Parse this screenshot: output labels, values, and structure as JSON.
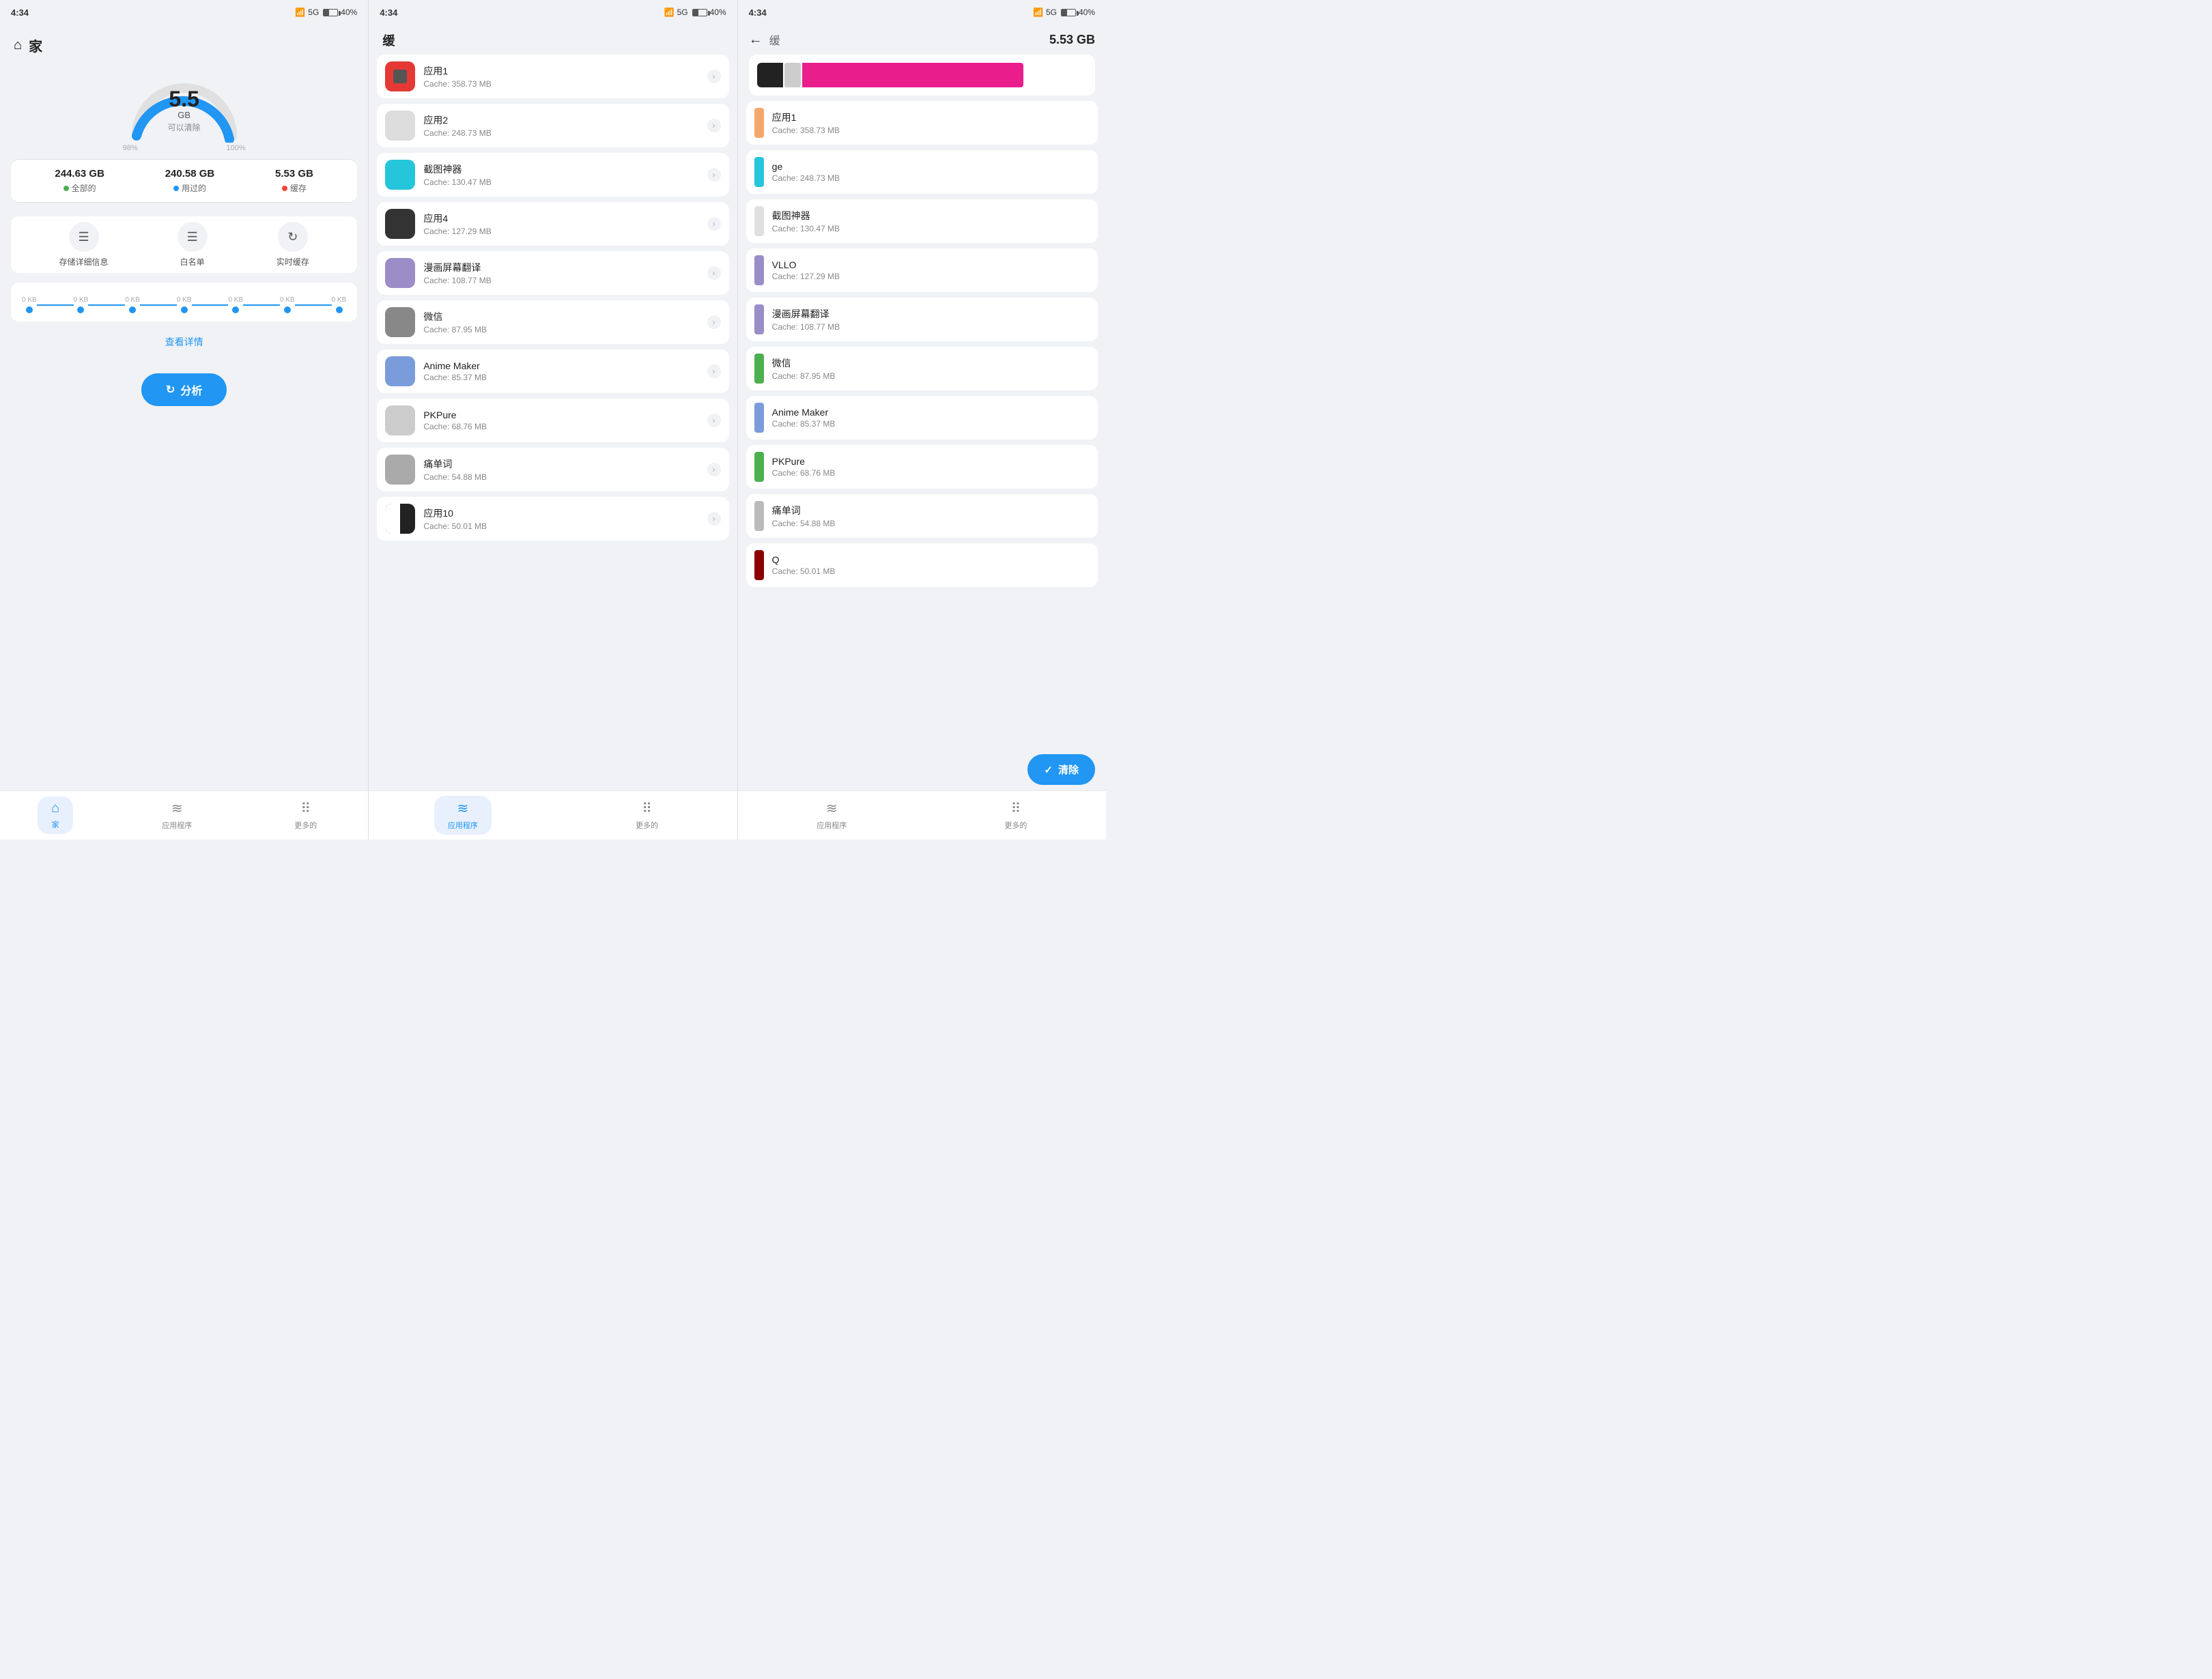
{
  "panels": [
    {
      "id": "panel1",
      "statusBar": {
        "time": "4:34",
        "battery": "40%",
        "signal": "5G"
      },
      "header": {
        "title": "家",
        "homeIcon": "⌂"
      },
      "gauge": {
        "value": "5.5",
        "unit": "GB",
        "label": "可以清除",
        "percent98": "98%",
        "percent100": "100%"
      },
      "stats": [
        {
          "value": "244.63 GB",
          "label": "全部的",
          "dotClass": "dot-green"
        },
        {
          "value": "240.58 GB",
          "label": "用过的",
          "dotClass": "dot-blue"
        },
        {
          "value": "5.53 GB",
          "label": "缓存",
          "dotClass": "dot-red"
        }
      ],
      "actions": [
        {
          "id": "storage-detail",
          "icon": "☰",
          "label": "存储详细信息"
        },
        {
          "id": "whitelist",
          "icon": "☰",
          "label": "白名单"
        },
        {
          "id": "realtime-cache",
          "icon": "↻",
          "label": "实时缓存"
        }
      ],
      "progressLabels": [
        "0 KB",
        "0 KB",
        "0 KB",
        "0 KB",
        "0 KB",
        "0 KB",
        "0 KB"
      ],
      "viewDetailsLabel": "查看详情",
      "analyzeLabel": "分析",
      "bottomNav": [
        {
          "id": "home",
          "icon": "⌂",
          "label": "家",
          "active": true
        },
        {
          "id": "apps",
          "icon": "≋",
          "label": "应用程序",
          "active": false
        },
        {
          "id": "more",
          "icon": "⠿",
          "label": "更多的",
          "active": false
        }
      ]
    },
    {
      "id": "panel2",
      "statusBar": {
        "time": "4:34",
        "battery": "40%"
      },
      "header": {
        "title": "缓"
      },
      "apps": [
        {
          "name": "应用1",
          "size": "Cache: 358.73 MB",
          "color": "#e53935"
        },
        {
          "name": "应用2",
          "size": "Cache: 248.73 MB",
          "color": "#bbb"
        },
        {
          "name": "截图神器",
          "size": "Cache: 130.47 MB",
          "color": "#5bb"
        },
        {
          "name": "应用4",
          "size": "Cache: 127.29 MB",
          "color": "#333"
        },
        {
          "name": "漫画屏幕翻译",
          "size": "Cache: 108.77 MB",
          "color": "#9b8dc8"
        },
        {
          "name": "微信",
          "size": "Cache: 87.95 MB",
          "color": "#777"
        },
        {
          "name": "Anime Maker",
          "size": "Cache: 85.37 MB",
          "color": "#7b9cda"
        },
        {
          "name": "PKPure",
          "size": "Cache: 68.76 MB",
          "color": "#aaa"
        },
        {
          "name": "痛单词",
          "size": "Cache: 54.88 MB",
          "color": "#999"
        },
        {
          "name": "应用10",
          "size": "Cache: 50.01 MB",
          "color": "#222"
        }
      ],
      "bottomNav": [
        {
          "id": "apps",
          "icon": "≋",
          "label": "应用程序",
          "active": true
        },
        {
          "id": "more",
          "icon": "⠿",
          "label": "更多的",
          "active": false
        }
      ]
    },
    {
      "id": "panel3",
      "statusBar": {
        "time": "4:34",
        "battery": "40%"
      },
      "header": {
        "backLabel": "←",
        "shortTitle": "缓",
        "total": "5.53 GB"
      },
      "chartSegments": [
        {
          "color": "#222",
          "width": "8%"
        },
        {
          "color": "#e0e0e0",
          "width": "5%"
        },
        {
          "color": "#e91e8c",
          "width": "67%"
        },
        {
          "color": "#f0f2f5",
          "width": "20%"
        }
      ],
      "detailItems": [
        {
          "name": "应用1",
          "size": "Cache: 358.73 MB",
          "color": "#f5a86a"
        },
        {
          "name": "ge",
          "size": "Cache: 248.73 MB",
          "color": "#26c6da"
        },
        {
          "name": "截图神器",
          "size": "Cache: 130.47 MB",
          "color": "#e0e0e0"
        },
        {
          "name": "VLLO",
          "size": "Cache: 127.29 MB",
          "color": "#9b8dc8"
        },
        {
          "name": "漫画屏幕翻译",
          "size": "Cache: 108.77 MB",
          "color": "#9b8dc8"
        },
        {
          "name": "微信",
          "size": "Cache: 87.95 MB",
          "color": "#4caf50"
        },
        {
          "name": "Anime Maker",
          "size": "Cache: 85.37 MB",
          "color": "#7b9cda"
        },
        {
          "name": "PKPure",
          "size": "Cache: 68.76 MB",
          "color": "#4caf50"
        },
        {
          "name": "痛单词",
          "size": "Cache: 54.88 MB",
          "color": "#aaa"
        },
        {
          "name": "Q",
          "size": "Cache: 50.01 MB",
          "color": "#8B0000"
        }
      ],
      "cleanLabel": "清除",
      "bottomNav": [
        {
          "id": "apps",
          "icon": "≋",
          "label": "应用程序",
          "active": false
        },
        {
          "id": "more",
          "icon": "⠿",
          "label": "更多的",
          "active": false
        }
      ]
    }
  ]
}
